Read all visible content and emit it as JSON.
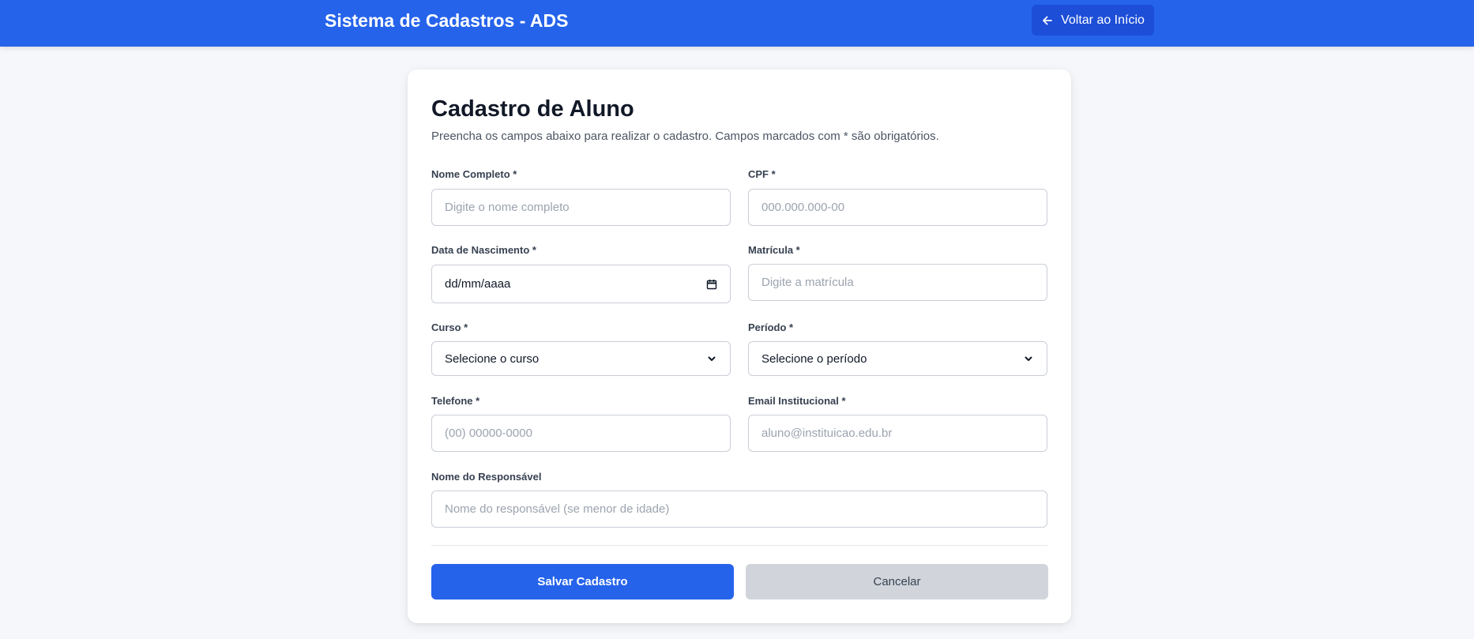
{
  "header": {
    "brand": "Sistema de Cadastros - ADS",
    "back_label": "Voltar ao Início",
    "colors": {
      "bar": "#2563eb",
      "button": "#1d4ed8"
    }
  },
  "form": {
    "title": "Cadastro de Aluno",
    "subtitle": "Preencha os campos abaixo para realizar o cadastro. Campos marcados com * são obrigatórios.",
    "fields": {
      "nome": {
        "label": "Nome Completo *",
        "placeholder": "Digite o nome completo",
        "value": ""
      },
      "cpf": {
        "label": "CPF *",
        "placeholder": "000.000.000-00",
        "value": ""
      },
      "nascimento": {
        "label": "Data de Nascimento *",
        "display": "dd/mm/aaaa",
        "icon": "calendar-icon"
      },
      "matricula": {
        "label": "Matrícula *",
        "placeholder": "Digite a matrícula",
        "value": ""
      },
      "curso": {
        "label": "Curso *",
        "selected": "Selecione o curso"
      },
      "periodo": {
        "label": "Período *",
        "selected": "Selecione o período"
      },
      "telefone": {
        "label": "Telefone *",
        "placeholder": "(00) 00000-0000",
        "value": ""
      },
      "email": {
        "label": "Email Institucional *",
        "placeholder": "aluno@instituicao.edu.br",
        "value": ""
      },
      "responsavel": {
        "label": "Nome do Responsável",
        "placeholder": "Nome do responsável (se menor de idade)",
        "value": ""
      }
    },
    "actions": {
      "save_label": "Salvar Cadastro",
      "cancel_label": "Cancelar"
    },
    "colors": {
      "primary": "#2563eb",
      "secondary": "#d1d5db"
    }
  }
}
